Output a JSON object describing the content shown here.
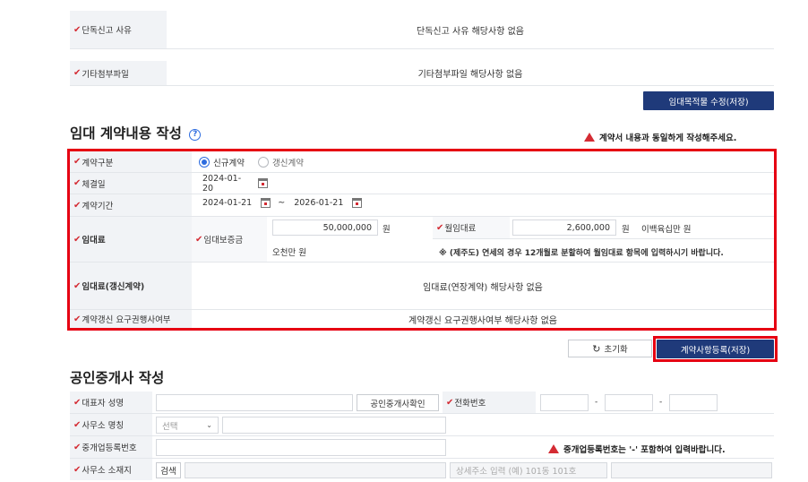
{
  "top_section": {
    "rows": [
      {
        "label": "단독신고 사유",
        "value": "단독신고 사유 해당사항 없음"
      },
      {
        "label": "기타첨부파일",
        "value": "기타첨부파일 해당사항 없음"
      }
    ],
    "save_button": "임대목적물 수정(저장)"
  },
  "contract": {
    "title": "임대 계약내용 작성",
    "notice": "계약서 내용과 동일하게 작성해주세요.",
    "type_label": "계약구분",
    "type_options": [
      "신규계약",
      "갱신계약"
    ],
    "date_label": "체결일",
    "date_value": "2024-01-20",
    "period_label": "계약기간",
    "period_start": "2024-01-21",
    "period_sep": "~",
    "period_end": "2026-01-21",
    "rent_label": "임대료",
    "deposit_label": "임대보증금",
    "deposit_value": "50,000,000",
    "won": "원",
    "deposit_korean": "오천만 원",
    "monthly_label": "월임대료",
    "monthly_value": "2,600,000",
    "monthly_korean": "이백육십만 원",
    "monthly_note": "※ (제주도) 연세의 경우 12개월로 분할하여 월임대료 항목에 입력하시기 바랍니다.",
    "renewal_label": "임대료(갱신계약)",
    "renewal_value": "임대료(연장계약) 해당사항 없음",
    "right_label": "계약갱신 요구권행사여부",
    "right_value": "계약갱신 요구권행사여부 해당사항 없음",
    "reset_button": "초기화",
    "register_button": "계약사항등록(저장)"
  },
  "broker": {
    "title": "공인중개사 작성",
    "rep_label": "대표자 성명",
    "confirm_button": "공인중개사확인",
    "phone_label": "전화번호",
    "phone_dash": "-",
    "office_label": "사무소 명칭",
    "office_select": "선택",
    "reg_label": "중개업등록번호",
    "reg_notice": "중개업등록번호는 '-' 포함하여 입력바랍니다.",
    "address_label": "사무소 소재지",
    "search_button": "검색",
    "address_detail_placeholder": "상세주소 입력 (예) 101동 101호"
  },
  "colors": {
    "accent_navy": "#1f3a7a",
    "highlight_red": "#e60012",
    "required_mark": "#d42b33"
  }
}
